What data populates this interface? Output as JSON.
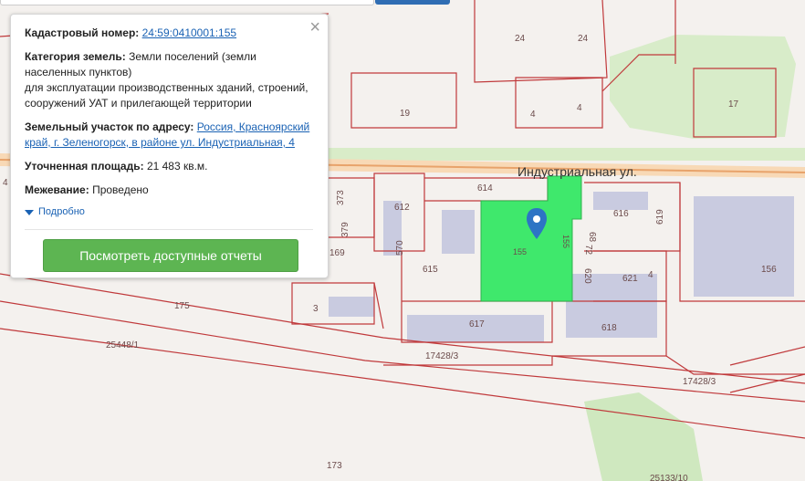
{
  "popup": {
    "cadastral_label": "Кадастровый номер:",
    "cadastral_value": "24:59:0410001:155",
    "category_label": "Категория земель:",
    "category_value_1": "Земли поселений (земли",
    "category_value_2": "населенных пунктов)",
    "usage_1": "для эксплуатации производственных зданий, строений,",
    "usage_2": "сооружений УАТ и прилегающей территории",
    "address_label": "Земельный участок по адресу:",
    "address_value_1": "Россия, Красноярский",
    "address_value_2": "край, г. Зеленогорск, в районе ул. Индустриальная, 4",
    "area_label": "Уточненная площадь:",
    "area_value": "21 483 кв.м.",
    "survey_label": "Межевание:",
    "survey_value": "Проведено",
    "more_label": "Подробно",
    "reports_button": "Посмотреть доступные отчеты",
    "close_icon": "×"
  },
  "map": {
    "street_label": "Индустриальная ул.",
    "selected_parcel_color": "#3fe86c",
    "marker_color": "#2d74c4",
    "labels": {
      "p24a": "24",
      "p24b": "24",
      "p17": "17",
      "p19": "19",
      "p4a": "4",
      "p4b": "4",
      "p614": "614",
      "p612": "612",
      "p616": "616",
      "p619": "619",
      "p373": "373",
      "p379": "379",
      "p169": "169",
      "p570": "570",
      "p615": "615",
      "p155a": "155",
      "p155b": "155",
      "p68": "68",
      "p72": "72",
      "p620": "620",
      "p621": "621",
      "p4c": "4",
      "p156": "156",
      "p175": "175",
      "p3": "3",
      "p617": "617",
      "p618": "618",
      "p25448": "25448/1",
      "p17428a": "17428/3",
      "p17428b": "17428/3",
      "p173": "173",
      "p25133": "25133/10",
      "p4d": "4"
    }
  }
}
